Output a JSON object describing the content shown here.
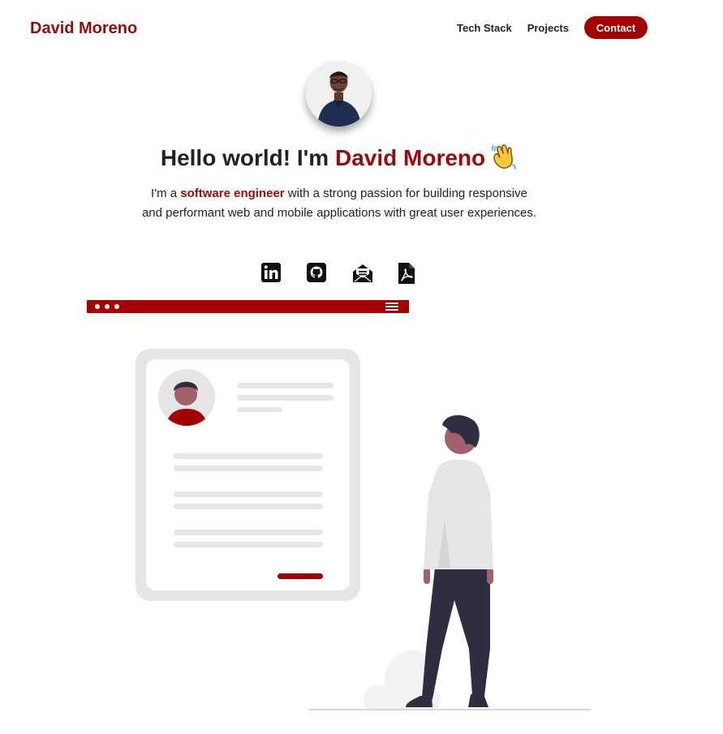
{
  "brand": {
    "name": "David Moreno"
  },
  "nav": {
    "tech_stack": "Tech Stack",
    "projects": "Projects",
    "contact": "Contact"
  },
  "hero": {
    "greeting": "Hello world! I'm ",
    "name": "David Moreno",
    "intro_prefix": "I'm a ",
    "intro_highlight": "software engineer",
    "intro_suffix": " with a strong passion for building responsive and performant web and mobile applications with great user experiences."
  },
  "socials": [
    "linkedin-icon",
    "github-icon",
    "email-icon",
    "pdf-resume-icon"
  ],
  "colors": {
    "accent": "#a30000",
    "text": "#222222",
    "illustration_gray": "#e6e6e6",
    "figure_dark": "#2f2e41"
  }
}
